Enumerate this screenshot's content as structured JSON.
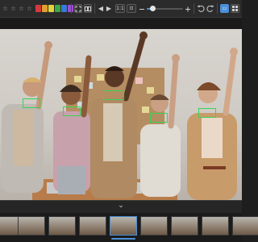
{
  "toolbar": {
    "rating_stars": [
      "☆",
      "☆",
      "☆",
      "☆",
      "☆"
    ],
    "color_labels": [
      "#d33b3b",
      "#e0a030",
      "#e4d33a",
      "#3aa845",
      "#3a7ad8",
      "#9d4fd0"
    ],
    "nav_prev": "◀",
    "nav_next": "▶",
    "zoom_label": "1:1",
    "fit_label": "⊡",
    "zoom_level": 0.15,
    "view_mode_label": "▭",
    "active_view": "single"
  },
  "viewer": {
    "face_boxes_color": "#39d353"
  },
  "filmstrip": {
    "collapse_label": "⌄",
    "selected_index": 3,
    "thumbnail_count": 9
  },
  "colors": {
    "accent": "#4a8fd8",
    "toolbar_bg": "#2b2b2b",
    "panel_bg": "#1e1e1e"
  }
}
